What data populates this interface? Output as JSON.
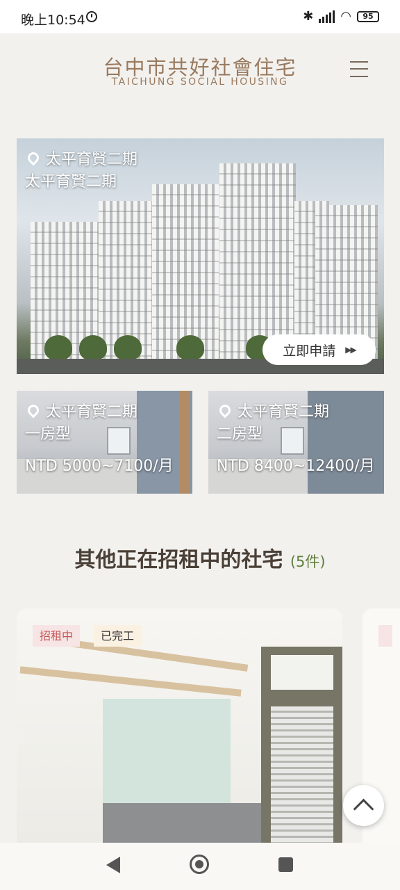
{
  "status_bar": {
    "time": "晚上10:54",
    "battery": "95"
  },
  "header": {
    "title": "台中市共好社會住宅",
    "subtitle": "TAICHUNG SOCIAL HOUSING"
  },
  "hero": {
    "location": "太平育賢二期",
    "title": "太平育賢二期",
    "apply_label": "立即申請",
    "apply_icon": "▶▶"
  },
  "units": [
    {
      "location": "太平育賢二期",
      "type": "一房型",
      "price": "NTD 5000~7100/月"
    },
    {
      "location": "太平育賢二期",
      "type": "二房型",
      "price": "NTD 8400~12400/月"
    }
  ],
  "section": {
    "title": "其他正在招租中的社宅",
    "count": "(5件)"
  },
  "listing": {
    "tags": [
      "招租中",
      "已完工"
    ]
  },
  "icons": {
    "location": "map-pin-icon",
    "back_to_top": "chevron-up-icon",
    "menu": "hamburger-menu-icon"
  },
  "colors": {
    "brand": "#9a7a5e",
    "tag_rent": "#c35454",
    "count": "#5f7d3c"
  }
}
